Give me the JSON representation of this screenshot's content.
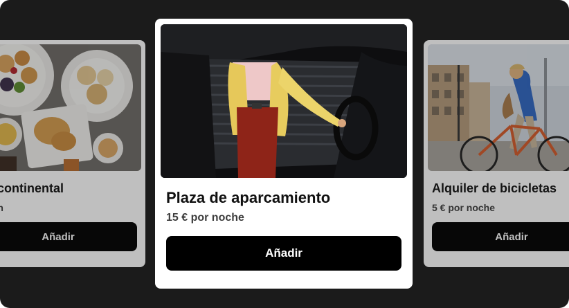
{
  "carousel": {
    "cards": [
      {
        "title": "o continental",
        "price": "son",
        "button_label": "Añadir",
        "image": "breakfast-buffet-photo"
      },
      {
        "title": "Plaza de aparcamiento",
        "price": "15 € por noche",
        "button_label": "Añadir",
        "image": "parking-car-photo"
      },
      {
        "title": "Alquiler de bicicletas",
        "price": "5 € por noche",
        "button_label": "Añadir",
        "image": "bicycle-rental-photo"
      }
    ]
  },
  "colors": {
    "backdrop": "#1b1b1b",
    "card": "#ffffff",
    "button": "#000000",
    "button_text": "#ffffff"
  }
}
